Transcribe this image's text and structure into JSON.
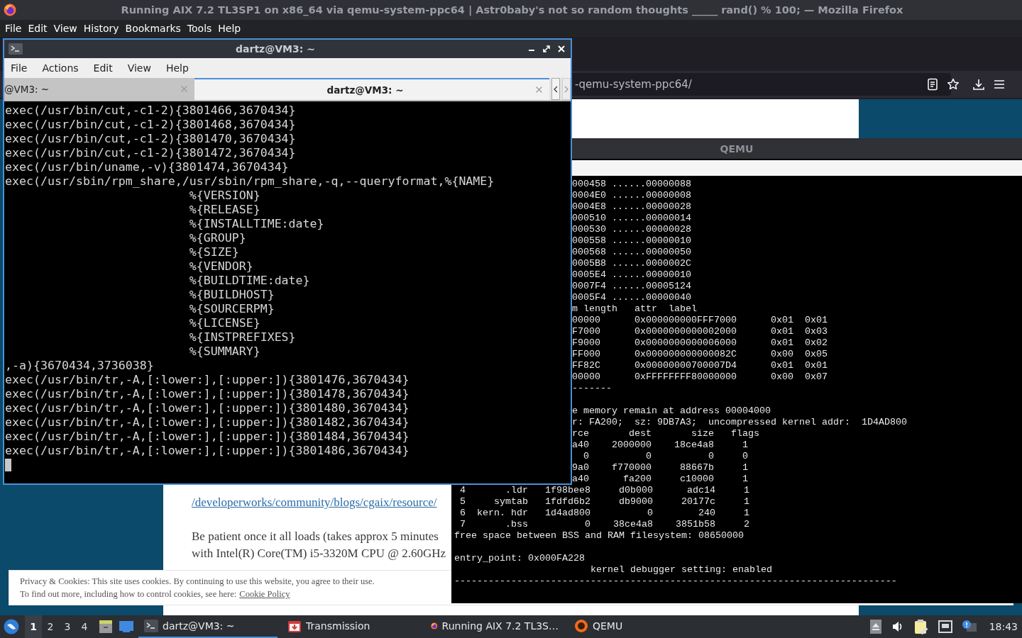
{
  "firefox": {
    "title": "Running AIX 7.2 TL3SP1 on x86_64 via qemu-system-ppc64 | Astr0baby's not so random thoughts _____ rand() % 100; — Mozilla Firefox",
    "menu": [
      "File",
      "Edit",
      "View",
      "History",
      "Bookmarks",
      "Tools",
      "Help"
    ],
    "url": "-qemu-system-ppc64/",
    "page": {
      "paragraphs": [
        {
          "lines": [
            {
              "text": "/developerworks/community/blogs/cgaix/resource/",
              "kind": "link"
            }
          ]
        },
        {
          "lines": [
            {
              "text": "Be patient once it all loads (takes approx 5 minutes",
              "kind": "text"
            },
            {
              "text": "with Intel(R) Core(TM) i5-3320M CPU @ 2.60GHz",
              "kind": "text"
            }
          ]
        }
      ]
    },
    "cookie_banner": {
      "text": "Privacy & Cookies: This site uses cookies. By continuing to use this website, you agree to their use.",
      "more": "To find out more, including how to control cookies, see here:",
      "link": "Cookie Policy"
    }
  },
  "terminal": {
    "title": "dartz@VM3: ~",
    "menu": [
      "File",
      "Actions",
      "Edit",
      "View",
      "Help"
    ],
    "tabs": [
      {
        "label": "@VM3: ~",
        "selected": false
      },
      {
        "label": "dartz@VM3: ~",
        "selected": true
      }
    ],
    "lines": [
      "exec(/usr/bin/cut,-c1-2){3801466,3670434}",
      "exec(/usr/bin/cut,-c1-2){3801468,3670434}",
      "exec(/usr/bin/cut,-c1-2){3801470,3670434}",
      "exec(/usr/bin/cut,-c1-2){3801472,3670434}",
      "exec(/usr/bin/uname,-v){3801474,3670434}",
      "exec(/usr/sbin/rpm_share,/usr/sbin/rpm_share,-q,--queryformat,%{NAME}",
      "                          %{VERSION}",
      "                          %{RELEASE}",
      "                          %{INSTALLTIME:date}",
      "                          %{GROUP}",
      "                          %{SIZE}",
      "                          %{VENDOR}",
      "                          %{BUILDTIME:date}",
      "                          %{BUILDHOST}",
      "                          %{SOURCERPM}",
      "                          %{LICENSE}",
      "                          %{INSTPREFIXES}",
      "                          %{SUMMARY}",
      ",-a){3670434,3736038}",
      "exec(/usr/bin/tr,-A,[:lower:],[:upper:]){3801476,3670434}",
      "exec(/usr/bin/tr,-A,[:lower:],[:upper:]){3801478,3670434}",
      "exec(/usr/bin/tr,-A,[:lower:],[:upper:]){3801480,3670434}",
      "exec(/usr/bin/tr,-A,[:lower:],[:upper:]){3801482,3670434}",
      "exec(/usr/bin/tr,-A,[:lower:],[:upper:]){3801484,3670434}",
      "exec(/usr/bin/tr,-A,[:lower:],[:upper:]){3801486,3670434}"
    ]
  },
  "qemu": {
    "title": "QEMU",
    "upper_blocks": [
      [
        "000458 ......00000088",
        "0004E0 ......00000008",
        "0004E8 ......00000028",
        "000510 ......00000014",
        "000530 ......00000028",
        "000558 ......00000010",
        "000568 ......00000050",
        "0005B8 ......0000002C",
        "0005E4 ......00000010",
        "0007F4 ......00005124",
        "0005F4 ......00000040",
        "m length   attr  label",
        "00000      0x000000000FFF7000      0x01  0x01",
        "F7000      0x0000000000002000      0x01  0x03",
        "F9000      0x0000000000006000      0x01  0x02",
        "FF000      0x000000000000082C      0x00  0x05",
        "FF82C      0x00000000700007D4      0x01  0x01",
        "00000      0xFFFFFFFF80000000      0x00  0x07",
        "-------"
      ],
      [
        "e memory remain at address 00004000",
        "r: FA200;  sz: 9DB7A3;  uncompressed kernel addr:  1D4AD800",
        "rce       dest       size   flags",
        "a40    2000000    18ce4a8     1",
        "  0          0          0     0",
        "9a0    f770000     88667b     1",
        "a40      fa200     c10000     1"
      ]
    ],
    "lower_blocks": [
      [
        " 4       .ldr   1f98bee8     d0b000      adc14     1",
        " 5     symtab   1fdfd6b2     db9000     20177c     1",
        " 6  kern. hdr   1d4ad800          0        240     1",
        " 7       .bss          0    38ce4a8    3851b58     2",
        "free space between BSS and RAM filesystem: 08650000"
      ],
      [
        "entry_point: 0x000FA228",
        "                        kernel debugger setting: enabled",
        "------------------------------------------------------------------------------"
      ]
    ]
  },
  "taskbar": {
    "workspaces": [
      {
        "label": "1",
        "selected": true
      },
      {
        "label": "2",
        "selected": false
      },
      {
        "label": "3",
        "selected": false
      },
      {
        "label": "4",
        "selected": false
      }
    ],
    "tasks": [
      {
        "kind": "terminal",
        "label": "dartz@VM3: ~",
        "selected": true
      },
      {
        "kind": "transmission",
        "label": "Transmission",
        "selected": false
      },
      {
        "kind": "firefox",
        "label": "Running AIX 7.2 TL3S…",
        "selected": false
      },
      {
        "kind": "qemu",
        "label": "QEMU",
        "selected": false
      }
    ],
    "clock": "18:43"
  }
}
